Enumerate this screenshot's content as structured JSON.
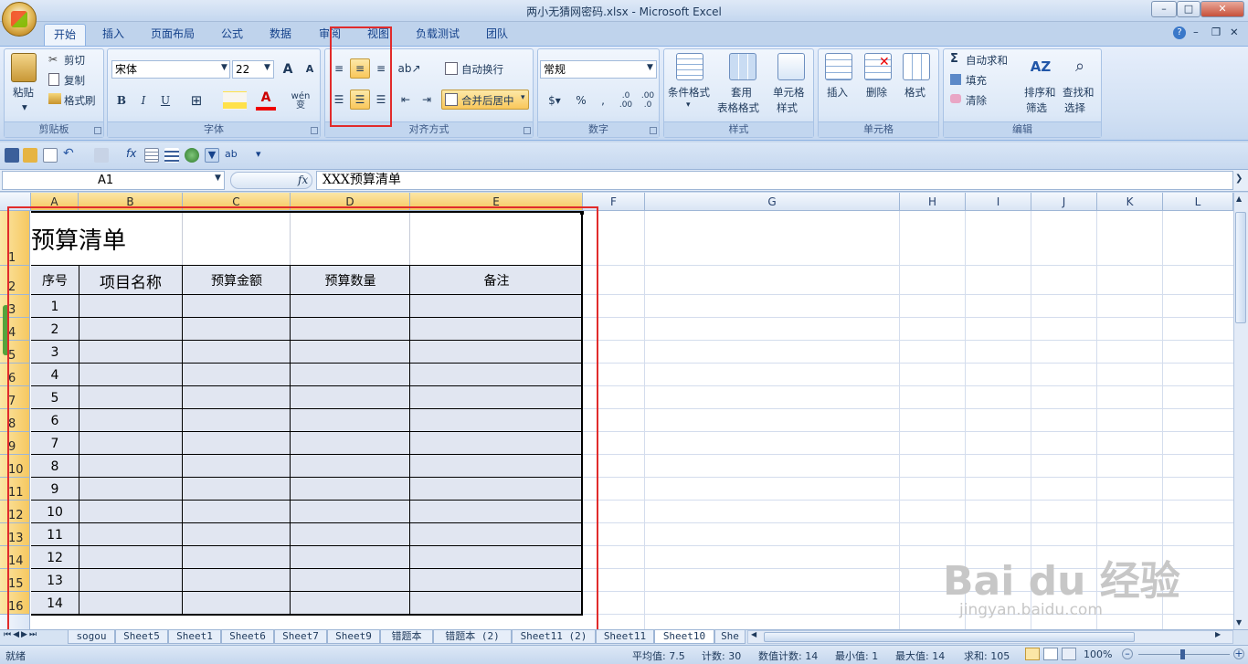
{
  "window": {
    "title": "两小无猜网密码.xlsx - Microsoft Excel",
    "min": "–",
    "max": "□",
    "close": "✕"
  },
  "tabs": [
    "开始",
    "插入",
    "页面布局",
    "公式",
    "数据",
    "审阅",
    "视图",
    "负载测试",
    "团队"
  ],
  "clipboard": {
    "paste": "粘贴",
    "cut": "剪切",
    "copy": "复制",
    "format_painter": "格式刷",
    "label": "剪贴板"
  },
  "font": {
    "name": "宋体",
    "size": "22",
    "bold": "B",
    "italic": "I",
    "underline": "U",
    "grow": "A",
    "shrink": "A",
    "label": "字体",
    "wen": "wén",
    "wen2": "变"
  },
  "alignment": {
    "wrap": "自动换行",
    "merge": "合并后居中",
    "label": "对齐方式"
  },
  "number": {
    "format": "常规",
    "percent": "%",
    "comma": ",",
    "dec_inc": ".0 .00",
    "dec_dec": ".00 .0",
    "label": "数字"
  },
  "styles": {
    "conditional": "条件格式",
    "table1": "套用",
    "table2": "表格格式",
    "cell1": "单元格",
    "cell2": "样式",
    "label": "样式"
  },
  "cells": {
    "insert": "插入",
    "delete": "删除",
    "format": "格式",
    "label": "单元格"
  },
  "editing": {
    "autosum": "自动求和",
    "fill": "填充",
    "clear": "清除",
    "sort1": "排序和",
    "sort2": "筛选",
    "find1": "查找和",
    "find2": "选择",
    "label": "编辑"
  },
  "formula": {
    "namebox": "A1",
    "fx": "fx",
    "content": "XXX预算清单"
  },
  "columns": [
    "A",
    "B",
    "C",
    "D",
    "E",
    "F",
    "G",
    "H",
    "I",
    "J",
    "K",
    "L"
  ],
  "rows": [
    "1",
    "2",
    "3",
    "4",
    "5",
    "6",
    "7",
    "8",
    "9",
    "10",
    "11",
    "12",
    "13",
    "14",
    "15",
    "16"
  ],
  "table": {
    "title": "预算清单",
    "headers": [
      "序号",
      "项目名称",
      "预算金额",
      "预算数量",
      "备注"
    ],
    "numbers": [
      "1",
      "2",
      "3",
      "4",
      "5",
      "6",
      "7",
      "8",
      "9",
      "10",
      "11",
      "12",
      "13",
      "14"
    ]
  },
  "sheets": [
    "sogou",
    "Sheet5",
    "Sheet1",
    "Sheet6",
    "Sheet7",
    "Sheet9",
    "错题本",
    "错题本 (2)",
    "Sheet11 (2)",
    "Sheet11",
    "Sheet10",
    "She"
  ],
  "active_sheet": "Sheet10",
  "status": {
    "ready": "就绪",
    "avg": "平均值: 7.5",
    "count": "计数: 30",
    "numcount": "数值计数: 14",
    "min": "最小值: 1",
    "max": "最大值: 14",
    "sum": "求和: 105",
    "zoom": "100%"
  },
  "watermark": {
    "brand": "Bai du 经验",
    "url": "jingyan.baidu.com"
  }
}
